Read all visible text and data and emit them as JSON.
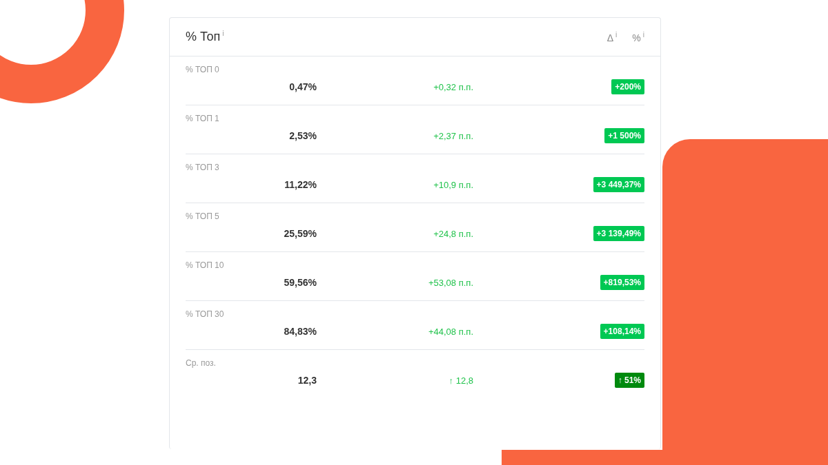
{
  "card": {
    "title": "% Топ",
    "title_info": "i",
    "columns": [
      {
        "label": "Δ",
        "info": "i"
      },
      {
        "label": "%",
        "info": "i"
      }
    ]
  },
  "rows": [
    {
      "label": "% ТОП 0",
      "value": "0,47%",
      "delta": "+0,32 п.п.",
      "change": "+200%",
      "color": "#00c853"
    },
    {
      "label": "% ТОП 1",
      "value": "2,53%",
      "delta": "+2,37 п.п.",
      "change": "+1 500%",
      "color": "#00c853"
    },
    {
      "label": "% ТОП 3",
      "value": "11,22%",
      "delta": "+10,9 п.п.",
      "change": "+3 449,37%",
      "color": "#00c853"
    },
    {
      "label": "% ТОП 5",
      "value": "25,59%",
      "delta": "+24,8 п.п.",
      "change": "+3 139,49%",
      "color": "#00c853"
    },
    {
      "label": "% ТОП 10",
      "value": "59,56%",
      "delta": "+53,08 п.п.",
      "change": "+819,53%",
      "color": "#00c853"
    },
    {
      "label": "% ТОП 30",
      "value": "84,83%",
      "delta": "+44,08 п.п.",
      "change": "+108,14%",
      "color": "#00c853"
    },
    {
      "label": "Ср. поз.",
      "value": "12,3",
      "delta": "↑ 12,8",
      "change": "↑ 51%",
      "color": "#008a0e"
    }
  ]
}
